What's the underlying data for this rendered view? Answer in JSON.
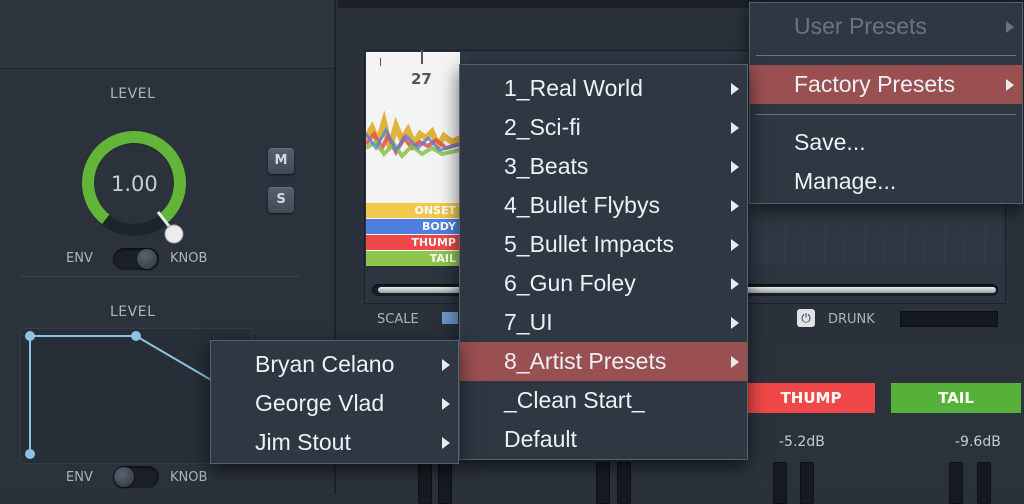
{
  "left_panel": {
    "level_label": "LEVEL",
    "knob_value": "1.00",
    "mute_label": "M",
    "solo_label": "S",
    "env_label": "ENV",
    "knob_label": "KNOB",
    "level_label_2": "LEVEL",
    "env_label_2": "ENV",
    "knob_label_2": "KNOB"
  },
  "waveform": {
    "ruler_marker": "27",
    "lanes": [
      "ONSET",
      "BODY",
      "THUMP",
      "TAIL"
    ],
    "lane_colors": [
      "#f2c94c",
      "#4f80e0",
      "#f04848",
      "#8cc64c"
    ]
  },
  "bottom": {
    "scale_label": "SCALE",
    "drunk_label": "DRUNK",
    "thump_label": "THUMP",
    "tail_label": "TAIL",
    "thump_db": "-5.2dB",
    "tail_db": "-9.6dB"
  },
  "main_menu": {
    "items": [
      {
        "label": "User Presets",
        "disabled": true,
        "submenu": true
      },
      {
        "label": "Factory Presets",
        "selected": true,
        "submenu": true
      },
      {
        "label": "Save..."
      },
      {
        "label": "Manage..."
      }
    ]
  },
  "factory_menu": {
    "items": [
      {
        "label": "1_Real World",
        "submenu": true
      },
      {
        "label": "2_Sci-fi",
        "submenu": true
      },
      {
        "label": "3_Beats",
        "submenu": true
      },
      {
        "label": "4_Bullet Flybys",
        "submenu": true
      },
      {
        "label": "5_Bullet Impacts",
        "submenu": true
      },
      {
        "label": "6_Gun Foley",
        "submenu": true
      },
      {
        "label": "7_UI",
        "submenu": true
      },
      {
        "label": "8_Artist Presets",
        "submenu": true,
        "selected": true
      },
      {
        "label": "_Clean Start_"
      },
      {
        "label": "Default"
      }
    ]
  },
  "artist_menu": {
    "items": [
      {
        "label": "Bryan Celano",
        "submenu": true
      },
      {
        "label": "George Vlad",
        "submenu": true
      },
      {
        "label": "Jim Stout",
        "submenu": true
      }
    ]
  },
  "colors": {
    "accent_green": "#63b53a",
    "menu_selected": "#9a4f51",
    "thump_red": "#f04848",
    "tail_green": "#56b13a"
  }
}
